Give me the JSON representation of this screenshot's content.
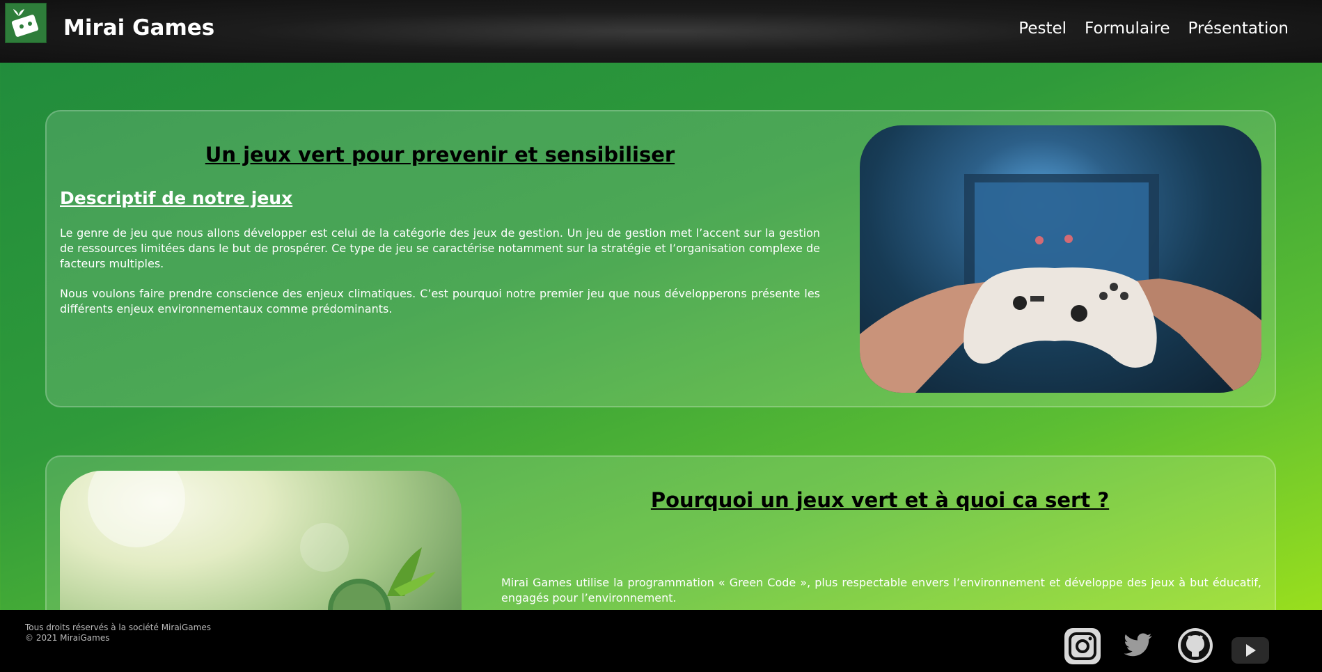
{
  "header": {
    "brand": "Mirai Games",
    "nav": [
      "Pestel",
      "Formulaire",
      "Présentation"
    ]
  },
  "section1": {
    "title": "Un jeux vert pour prevenir et sensibiliser",
    "subtitle": "Descriptif de notre jeux",
    "paragraph1": "Le genre de jeu que nous allons développer est celui de la catégorie des jeux de gestion. Un jeu de gestion met l’accent sur la gestion de ressources limitées dans le but de prospérer. Ce type de jeu se caractérise notamment sur la stratégie et l’organisation complexe de facteurs multiples.",
    "paragraph2": "Nous voulons faire prendre conscience des enjeux climatiques. C’est pourquoi notre premier jeu que nous développerons présente les différents enjeux environnementaux comme prédominants."
  },
  "section2": {
    "title": "Pourquoi un jeux vert et à quoi ca sert ?",
    "paragraph1": "Mirai Games utilise la programmation « Green Code », plus respectable envers l’environnement et développe des jeux à but éducatif, engagés pour l’environnement."
  },
  "footer": {
    "rights": "Tous droits réservés à la société MiraiGames",
    "copyright": "© 2021 MiraiGames"
  },
  "icons": {
    "logo": "mirai-games-logo",
    "social": [
      "instagram-icon",
      "twitter-icon",
      "github-icon",
      "youtube-icon"
    ]
  },
  "colors": {
    "header_bg": "#1c1c1c",
    "gradient_start": "#1f8a3c",
    "gradient_end": "#a7e619",
    "footer_bg": "#000000"
  }
}
